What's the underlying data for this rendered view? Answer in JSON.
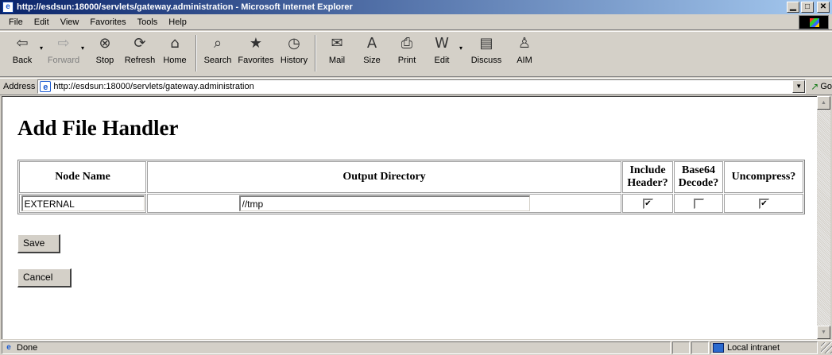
{
  "window": {
    "title": "http://esdsun:18000/servlets/gateway.administration - Microsoft Internet Explorer",
    "minimize": "▁",
    "maximize": "□",
    "close": "✕"
  },
  "menu": {
    "items": [
      "File",
      "Edit",
      "View",
      "Favorites",
      "Tools",
      "Help"
    ]
  },
  "toolbar": {
    "buttons": [
      {
        "label": "Back",
        "icon": "back-arrow-icon",
        "glyph": "⇦"
      },
      {
        "label": "Forward",
        "icon": "forward-arrow-icon",
        "glyph": "⇨"
      },
      {
        "label": "Stop",
        "icon": "stop-icon",
        "glyph": "⊗"
      },
      {
        "label": "Refresh",
        "icon": "refresh-icon",
        "glyph": "⟳"
      },
      {
        "label": "Home",
        "icon": "home-icon",
        "glyph": "⌂"
      },
      {
        "label": "Search",
        "icon": "search-icon",
        "glyph": "⌕"
      },
      {
        "label": "Favorites",
        "icon": "favorites-icon",
        "glyph": "★"
      },
      {
        "label": "History",
        "icon": "history-icon",
        "glyph": "◷"
      },
      {
        "label": "Mail",
        "icon": "mail-icon",
        "glyph": "✉"
      },
      {
        "label": "Size",
        "icon": "font-size-icon",
        "glyph": "A"
      },
      {
        "label": "Print",
        "icon": "print-icon",
        "glyph": "⎙"
      },
      {
        "label": "Edit",
        "icon": "edit-icon",
        "glyph": "W"
      },
      {
        "label": "Discuss",
        "icon": "discuss-icon",
        "glyph": "▤"
      },
      {
        "label": "AIM",
        "icon": "aim-icon",
        "glyph": "♙"
      }
    ]
  },
  "address": {
    "label": "Address",
    "url": "http://esdsun:18000/servlets/gateway.administration",
    "go_label": "Go",
    "ie_glyph": "e",
    "go_glyph": "↗",
    "drop_glyph": "▼"
  },
  "page": {
    "title": "Add File Handler",
    "table": {
      "headers": {
        "node_name": "Node Name",
        "output_directory": "Output Directory",
        "include_header_1": "Include",
        "include_header_2": "Header?",
        "base64_1": "Base64",
        "base64_2": "Decode?",
        "uncompress": "Uncompress?"
      },
      "row": {
        "node_name": "EXTERNAL",
        "output_directory": "//tmp",
        "include_header": "✔",
        "base64_decode": "",
        "uncompress": "✔"
      }
    },
    "save_label": "Save",
    "cancel_label": "Cancel"
  },
  "scroll": {
    "up": "▲",
    "down": "▼"
  },
  "status": {
    "text": "Done",
    "zone": "Local intranet",
    "ie_glyph": "e"
  }
}
